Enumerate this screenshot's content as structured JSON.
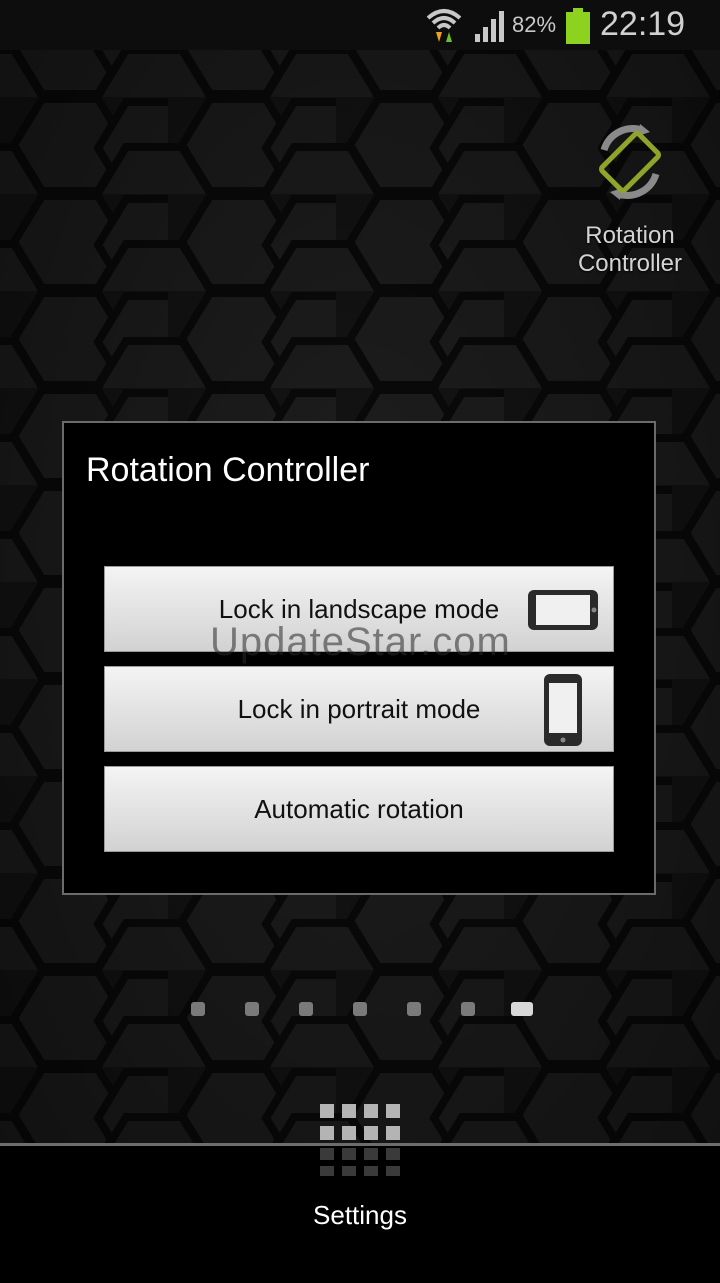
{
  "status_bar": {
    "battery_percent": "82%",
    "time": "22:19",
    "wifi_icon": "wifi-data-arrows-icon",
    "signal_icon": "cell-signal-icon",
    "battery_icon": "battery-icon",
    "battery_color": "#8cd21e"
  },
  "home_widget": {
    "label": "Rotation Controller",
    "icon": "rotate-screen-icon"
  },
  "dialog": {
    "title": "Rotation Controller",
    "buttons": [
      {
        "label": "Lock in landscape mode",
        "icon": "phone-landscape-icon"
      },
      {
        "label": "Lock in portrait mode",
        "icon": "phone-portrait-icon"
      },
      {
        "label": "Automatic rotation"
      }
    ]
  },
  "watermark": "UpdateStar.com",
  "page_indicator": {
    "count": 7,
    "active_index": 6
  },
  "dock": {
    "apps_icon": "app-grid-icon",
    "label": "Settings"
  }
}
